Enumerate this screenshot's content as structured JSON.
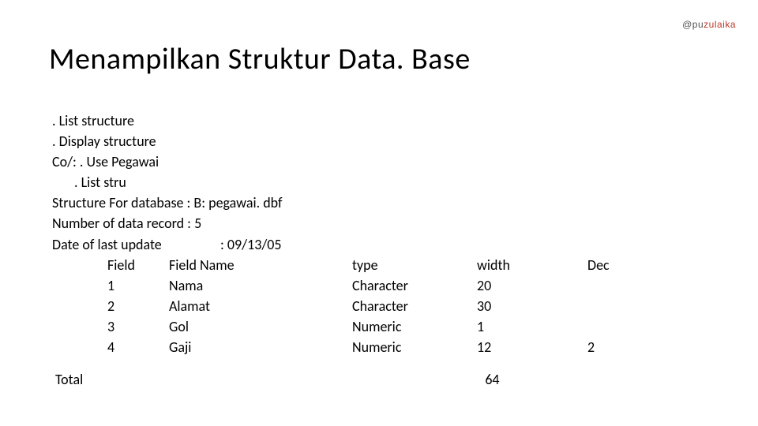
{
  "watermark": {
    "plain": "@pu",
    "accent": "zulaika"
  },
  "title": "Menampilkan Struktur Data. Base",
  "lines": {
    "l1": ". List structure",
    "l2": ". Display structure",
    "l3": "Co/: . Use Pegawai",
    "l4": ". List stru",
    "l5": "Structure For database : B: pegawai. dbf",
    "l6": "Number of data record : 5",
    "l7_label": "Date of last update",
    "l7_value": ": 09/13/05"
  },
  "headers": {
    "field": "Field",
    "name": "Field Name",
    "type": "type",
    "width": "width",
    "dec": "Dec"
  },
  "fields": [
    {
      "idx": "1",
      "name": "Nama",
      "type": "Character",
      "width": "20",
      "dec": ""
    },
    {
      "idx": "2",
      "name": "Alamat",
      "type": "Character",
      "width": "30",
      "dec": ""
    },
    {
      "idx": "3",
      "name": "Gol",
      "type": "Numeric",
      "width": "1",
      "dec": ""
    },
    {
      "idx": "4",
      "name": "Gaji",
      "type": "Numeric",
      "width": "12",
      "dec": "2"
    }
  ],
  "total": {
    "label": "Total",
    "value": "64"
  },
  "chart_data": {
    "type": "table",
    "title": "Menampilkan Struktur Data. Base",
    "columns": [
      "Field",
      "Field Name",
      "type",
      "width",
      "Dec"
    ],
    "rows": [
      [
        "1",
        "Nama",
        "Character",
        20,
        null
      ],
      [
        "2",
        "Alamat",
        "Character",
        30,
        null
      ],
      [
        "3",
        "Gol",
        "Numeric",
        1,
        null
      ],
      [
        "4",
        "Gaji",
        "Numeric",
        12,
        2
      ]
    ],
    "total_width": 64,
    "record_count": 5,
    "last_update": "09/13/05",
    "database": "B: pegawai. dbf"
  }
}
